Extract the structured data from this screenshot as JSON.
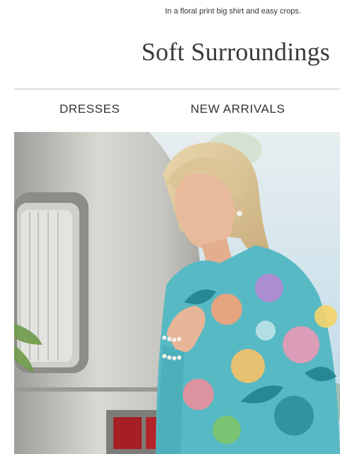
{
  "preheader": {
    "text": "In a floral print big shirt and easy crops."
  },
  "brand": {
    "logo_text": "Soft Surroundings"
  },
  "nav": {
    "items": [
      {
        "label": "DRESSES"
      },
      {
        "label": "NEW ARRIVALS"
      }
    ]
  },
  "hero": {
    "image_subject": "woman-floral-shirt-airstream-trailer"
  },
  "colors": {
    "text": "#333333",
    "divider": "#bdbdbd",
    "floral_teal": "#3aa7b5",
    "floral_pink": "#e79ab6"
  }
}
